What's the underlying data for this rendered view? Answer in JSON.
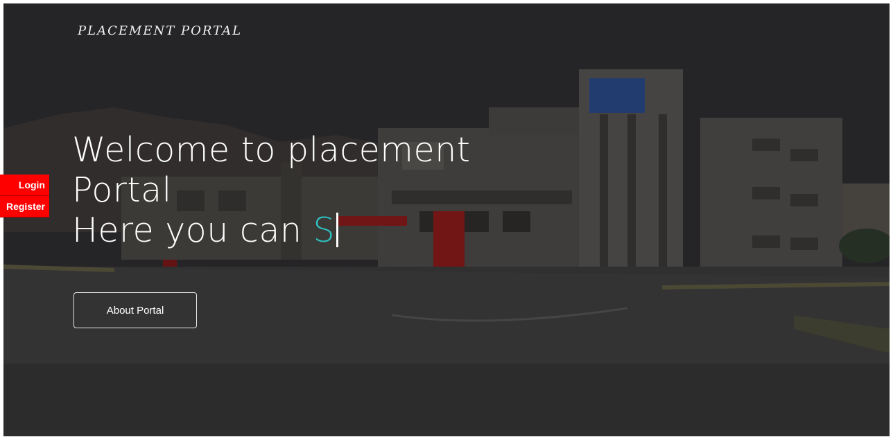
{
  "header": {
    "logo_text": "PLACEMENT PORTAL"
  },
  "side_nav": {
    "login_label": "Login",
    "register_label": "Register"
  },
  "hero": {
    "line1": "Welcome to placement",
    "line2": "Portal",
    "line3_prefix": "Here you can ",
    "line3_typed": "S",
    "about_button_label": "About Portal",
    "accent_color": "#2ec4c4",
    "tab_color": "#ff0000"
  }
}
